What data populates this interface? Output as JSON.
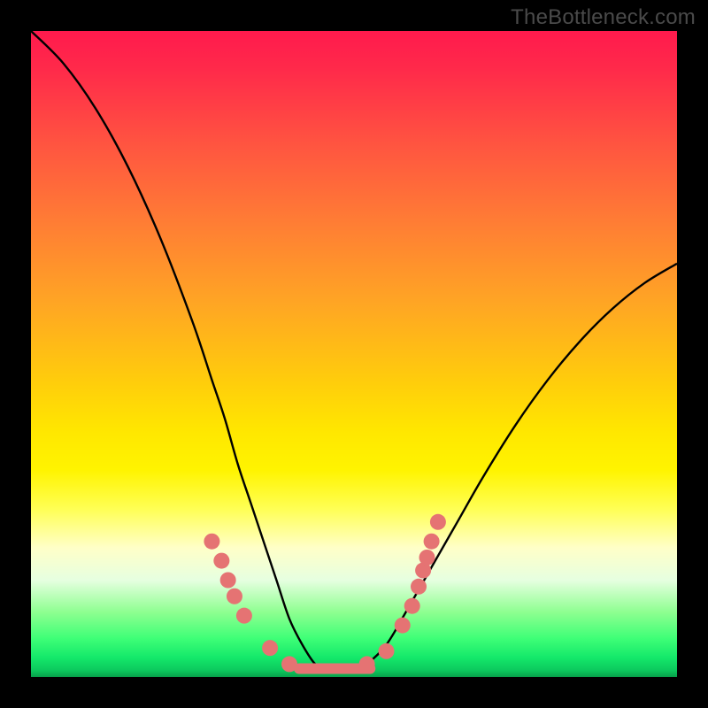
{
  "attribution": "TheBottleneck.com",
  "colors": {
    "frame": "#000000",
    "curve": "#000000",
    "marker": "#e57373"
  },
  "chart_data": {
    "type": "line",
    "title": "",
    "xlabel": "",
    "ylabel": "",
    "xlim": [
      0,
      100
    ],
    "ylim": [
      0,
      100
    ],
    "grid": false,
    "legend": false,
    "series": [
      {
        "name": "bottleneck-curve",
        "x": [
          0,
          5,
          10,
          15,
          20,
          25,
          28,
          30,
          32,
          34,
          36,
          38,
          40,
          42,
          44,
          46,
          48,
          50,
          52,
          55,
          58,
          62,
          66,
          70,
          75,
          80,
          85,
          90,
          95,
          100
        ],
        "y": [
          100,
          95,
          88,
          79,
          68,
          55,
          46,
          40,
          33,
          27,
          21,
          15,
          9,
          5,
          2,
          1,
          1,
          1,
          2,
          5,
          10,
          17,
          24,
          31,
          39,
          46,
          52,
          57,
          61,
          64
        ]
      }
    ],
    "markers": {
      "name": "highlight-dots",
      "points": [
        {
          "x": 28.0,
          "y": 21.0
        },
        {
          "x": 29.5,
          "y": 18.0
        },
        {
          "x": 30.5,
          "y": 15.0
        },
        {
          "x": 31.5,
          "y": 12.5
        },
        {
          "x": 33.0,
          "y": 9.5
        },
        {
          "x": 37.0,
          "y": 4.5
        },
        {
          "x": 40.0,
          "y": 2.0
        },
        {
          "x": 52.0,
          "y": 2.0
        },
        {
          "x": 55.0,
          "y": 4.0
        },
        {
          "x": 57.5,
          "y": 8.0
        },
        {
          "x": 59.0,
          "y": 11.0
        },
        {
          "x": 60.0,
          "y": 14.0
        },
        {
          "x": 60.7,
          "y": 16.5
        },
        {
          "x": 61.3,
          "y": 18.5
        },
        {
          "x": 62.0,
          "y": 21.0
        },
        {
          "x": 63.0,
          "y": 24.0
        }
      ],
      "radius": 9
    },
    "flat_segment": {
      "x0": 41.5,
      "x1": 52.5,
      "y": 1.3
    }
  }
}
